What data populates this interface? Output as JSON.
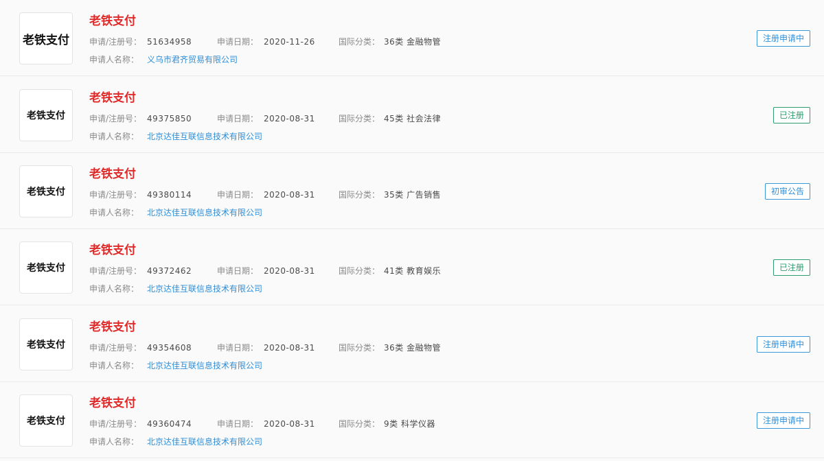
{
  "colors": {
    "name_red": "#e02a2a",
    "link_blue": "#2f8fd8",
    "badge_blue": "#3a98d8",
    "badge_green": "#2e9c6e"
  },
  "labels": {
    "reg_no": "申请/注册号：",
    "apply_date": "申请日期：",
    "intl_class": "国际分类：",
    "applicant": "申请人名称："
  },
  "items": [
    {
      "logo_text": "老铁支付",
      "name": "老铁支付",
      "reg_no": "51634958",
      "apply_date": "2020-11-26",
      "intl_class": "36类 金融物管",
      "applicant": "义乌市君齐贸易有限公司",
      "status": "注册申请中"
    },
    {
      "logo_text": "老铁支付",
      "name": "老铁支付",
      "reg_no": "49375850",
      "apply_date": "2020-08-31",
      "intl_class": "45类 社会法律",
      "applicant": "北京达佳互联信息技术有限公司",
      "status": "已注册"
    },
    {
      "logo_text": "老铁支付",
      "name": "老铁支付",
      "reg_no": "49380114",
      "apply_date": "2020-08-31",
      "intl_class": "35类 广告销售",
      "applicant": "北京达佳互联信息技术有限公司",
      "status": "初审公告"
    },
    {
      "logo_text": "老铁支付",
      "name": "老铁支付",
      "reg_no": "49372462",
      "apply_date": "2020-08-31",
      "intl_class": "41类 教育娱乐",
      "applicant": "北京达佳互联信息技术有限公司",
      "status": "已注册"
    },
    {
      "logo_text": "老铁支付",
      "name": "老铁支付",
      "reg_no": "49354608",
      "apply_date": "2020-08-31",
      "intl_class": "36类 金融物管",
      "applicant": "北京达佳互联信息技术有限公司",
      "status": "注册申请中"
    },
    {
      "logo_text": "老铁支付",
      "name": "老铁支付",
      "reg_no": "49360474",
      "apply_date": "2020-08-31",
      "intl_class": "9类 科学仪器",
      "applicant": "北京达佳互联信息技术有限公司",
      "status": "注册申请中"
    }
  ]
}
